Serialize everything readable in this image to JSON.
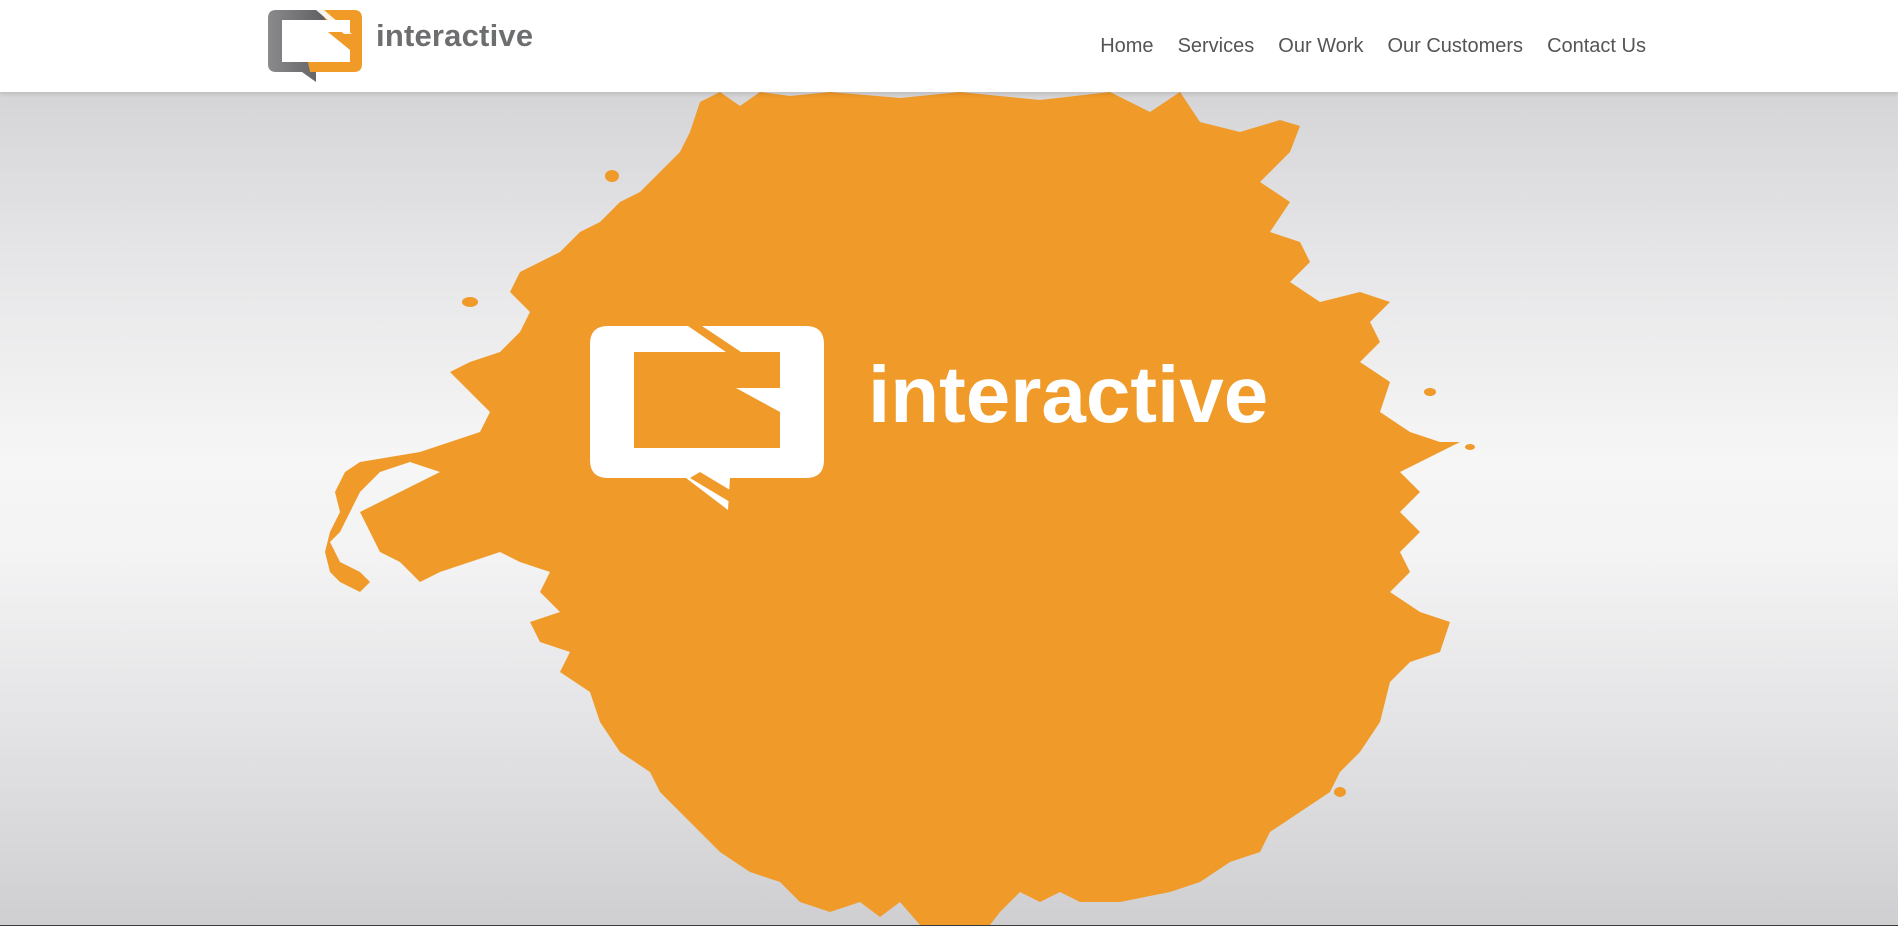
{
  "brand": {
    "name": "interactive",
    "icon": "speech-bubble-logo-icon",
    "colors": {
      "orange": "#f09a28",
      "gray": "#7a7a7c"
    }
  },
  "nav": {
    "items": [
      {
        "label": "Home"
      },
      {
        "label": "Services"
      },
      {
        "label": "Our Work"
      },
      {
        "label": "Our Customers"
      },
      {
        "label": "Contact Us"
      }
    ]
  },
  "hero": {
    "logo_text": "interactive",
    "splash_color": "#ef9a29",
    "logo_color": "#ffffff"
  }
}
